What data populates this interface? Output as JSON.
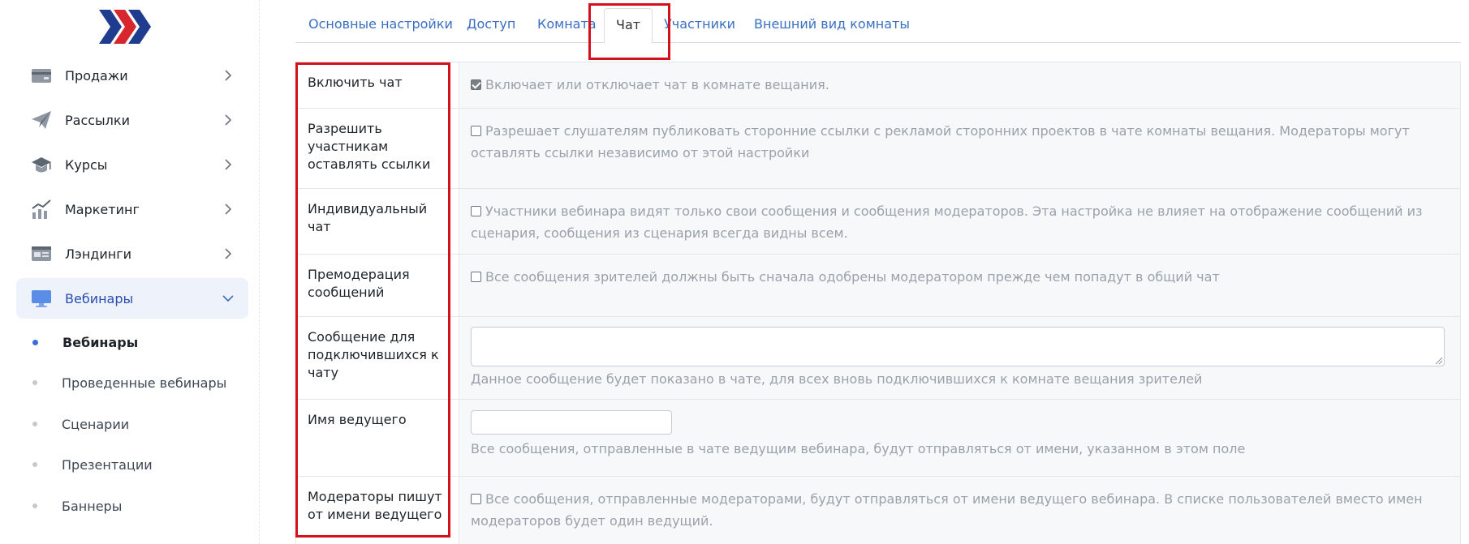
{
  "colors": {
    "accent": "#3a6fc4",
    "highlight": "#d4101c",
    "logo_blue": "#1f3c8f",
    "logo_red": "#d8262e"
  },
  "sidebar": {
    "logo": "brand-logo",
    "items": [
      {
        "label": "Продажи",
        "icon": "credit-card-icon"
      },
      {
        "label": "Рассылки",
        "icon": "paper-plane-icon"
      },
      {
        "label": "Курсы",
        "icon": "graduation-cap-icon"
      },
      {
        "label": "Маркетинг",
        "icon": "chart-growth-icon"
      },
      {
        "label": "Лэндинги",
        "icon": "landing-page-icon"
      },
      {
        "label": "Вебинары",
        "icon": "monitor-icon",
        "active": true
      }
    ],
    "sub_items": [
      {
        "label": "Вебинары",
        "active": true
      },
      {
        "label": "Проведенные вебинары"
      },
      {
        "label": "Сценарии"
      },
      {
        "label": "Презентации"
      },
      {
        "label": "Баннеры"
      }
    ]
  },
  "tabs": [
    {
      "label": "Основные настройки"
    },
    {
      "label": "Доступ"
    },
    {
      "label": "Комната"
    },
    {
      "label": "Чат",
      "active": true
    },
    {
      "label": "Участники"
    },
    {
      "label": "Внешний вид комнаты"
    }
  ],
  "settings": [
    {
      "label": "Включить чат",
      "checked": true,
      "description": "Включает или отключает чат в комнате вещания."
    },
    {
      "label": "Разрешить участникам оставлять ссылки",
      "checked": false,
      "description": "Разрешает слушателям публиковать сторонние ссылки с рекламой сторонних проектов в чате комнаты вещания. Модераторы могут оставлять ссылки независимо от этой настройки"
    },
    {
      "label": "Индивидуальный чат",
      "checked": false,
      "description": "Участники вебинара видят только свои сообщения и сообщения модераторов. Эта настройка не влияет на отображение сообщений из сценария, сообщения из сценария всегда видны всем."
    },
    {
      "label": "Премодерация сообщений",
      "checked": false,
      "description": "Все сообщения зрителей должны быть сначала одобрены модератором прежде чем попадут в общий чат"
    },
    {
      "label": "Сообщение для подключившихся к чату",
      "field_value": "",
      "description": "Данное сообщение будет показано в чате, для всех вновь подключившихся к комнате вещания зрителей"
    },
    {
      "label": "Имя ведущего",
      "field_value": "",
      "description": "Все сообщения, отправленные в чате ведущим вебинара, будут отправляться от имени, указанном в этом поле"
    },
    {
      "label": "Модераторы пишут от имени ведущего",
      "checked": false,
      "description": "Все сообщения, отправленные модераторами, будут отправляться от имени ведущего вебинара. В списке пользователей вместо имен модераторов будет один ведущий."
    }
  ]
}
